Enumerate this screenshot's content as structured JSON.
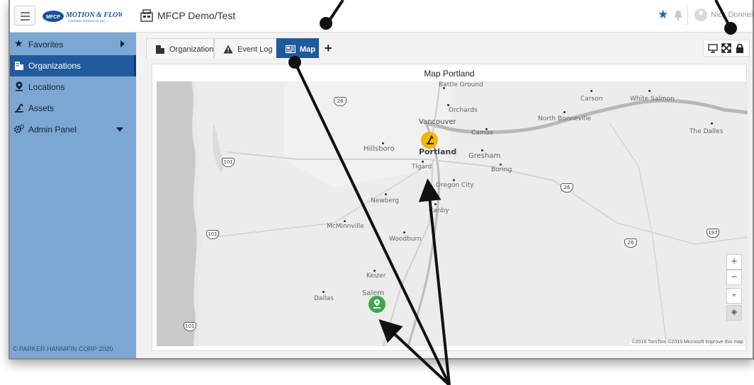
{
  "topbar": {
    "logo_text": "MOTION & FLOW",
    "logo_badge": "MFCP",
    "logo_sub": "CONTROL PRODUCTS, INC.",
    "workspace_title": "MFCP Demo/Test",
    "user_name": "Nick Donnelly"
  },
  "sidebar": {
    "items": [
      {
        "label": "Favorites",
        "icon": "star-icon"
      },
      {
        "label": "Organizations",
        "icon": "building-icon"
      },
      {
        "label": "Locations",
        "icon": "location-pin-icon"
      },
      {
        "label": "Assets",
        "icon": "asset-icon"
      },
      {
        "label": "Admin Panel",
        "icon": "gears-icon"
      }
    ],
    "copyright": "© PARKER HANNIFIN CORP 2020"
  },
  "tabs": [
    {
      "label": "Organization",
      "icon": "building-icon"
    },
    {
      "label": "Event Log",
      "icon": "warning-icon"
    },
    {
      "label": "Map",
      "icon": "map-icon"
    }
  ],
  "map": {
    "title": "Map Portland",
    "credit": "©2019 TomTom ©2019 Microsoft  Improve this map",
    "cities": {
      "battle_ground": "Battle Ground",
      "orchards": "Orchards",
      "vancouver": "Vancouver",
      "camas": "Camas",
      "carson": "Carson",
      "white_salmon": "White Salmon",
      "north_bonneville": "North Bonneville",
      "the_dalles": "The Dalles",
      "hillsboro": "Hillsboro",
      "portland": "Portland",
      "gresham": "Gresham",
      "tigard": "Tigard",
      "boring": "Boring",
      "oregon_city": "Oregon City",
      "newberg": "Newberg",
      "canby": "Canby",
      "mcminnville": "McMinnville",
      "woodburn": "Woodburn",
      "keizer": "Keizer",
      "dallas": "Dallas",
      "salem": "Salem"
    },
    "shields": [
      "26",
      "101",
      "26",
      "101",
      "197",
      "26",
      "101"
    ],
    "zoom_in": "+",
    "zoom_out": "−"
  },
  "colors": {
    "sidebar_bg": "#7ba7d2",
    "sidebar_active": "#1f5a9c",
    "accent": "#1a63b3",
    "pin_yellow": "#f2b705",
    "pin_green": "#3aaa4a"
  }
}
